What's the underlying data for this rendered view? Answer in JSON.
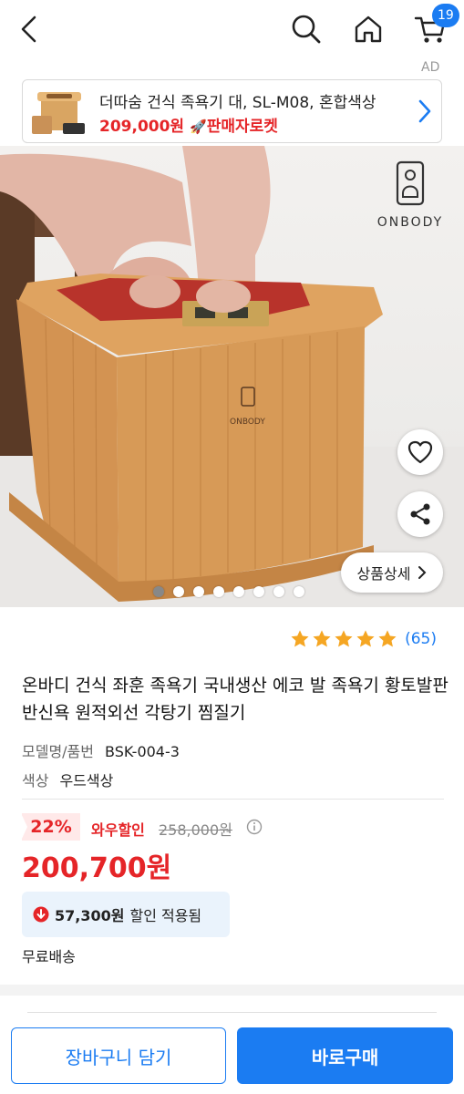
{
  "header": {
    "cart_count": "19",
    "ad_label": "AD"
  },
  "ad_banner": {
    "title": "더따숨 건식 족욕기 대, SL-M08, 혼합색상",
    "price": "209,000원",
    "rocket_label": "판매자로켓"
  },
  "hero": {
    "brand": "ONBODY",
    "detail_button": "상품상세",
    "slide_count": 8,
    "active_slide": 1
  },
  "rating": {
    "stars": 5,
    "count": "(65)"
  },
  "product": {
    "title": "온바디 건식 좌훈 족욕기 국내생산 에코 발 족욕기 황토발판 반신욕 원적외선 각탕기 찜질기",
    "model_label": "모델명/품번",
    "model_value": "BSK-004-3",
    "color_label": "색상",
    "color_value": "우드색상"
  },
  "price": {
    "discount": "22%",
    "wow_label": "와우할인",
    "original": "258,000원",
    "final": "200,700원",
    "coupon_amount": "57,300원",
    "coupon_text": "할인 적용됨",
    "shipping": "무료배송"
  },
  "actions": {
    "cart": "장바구니 담기",
    "buy": "바로구매"
  },
  "colors": {
    "accent": "#1b7cf2",
    "price_red": "#e52528",
    "star": "#f5a623"
  }
}
